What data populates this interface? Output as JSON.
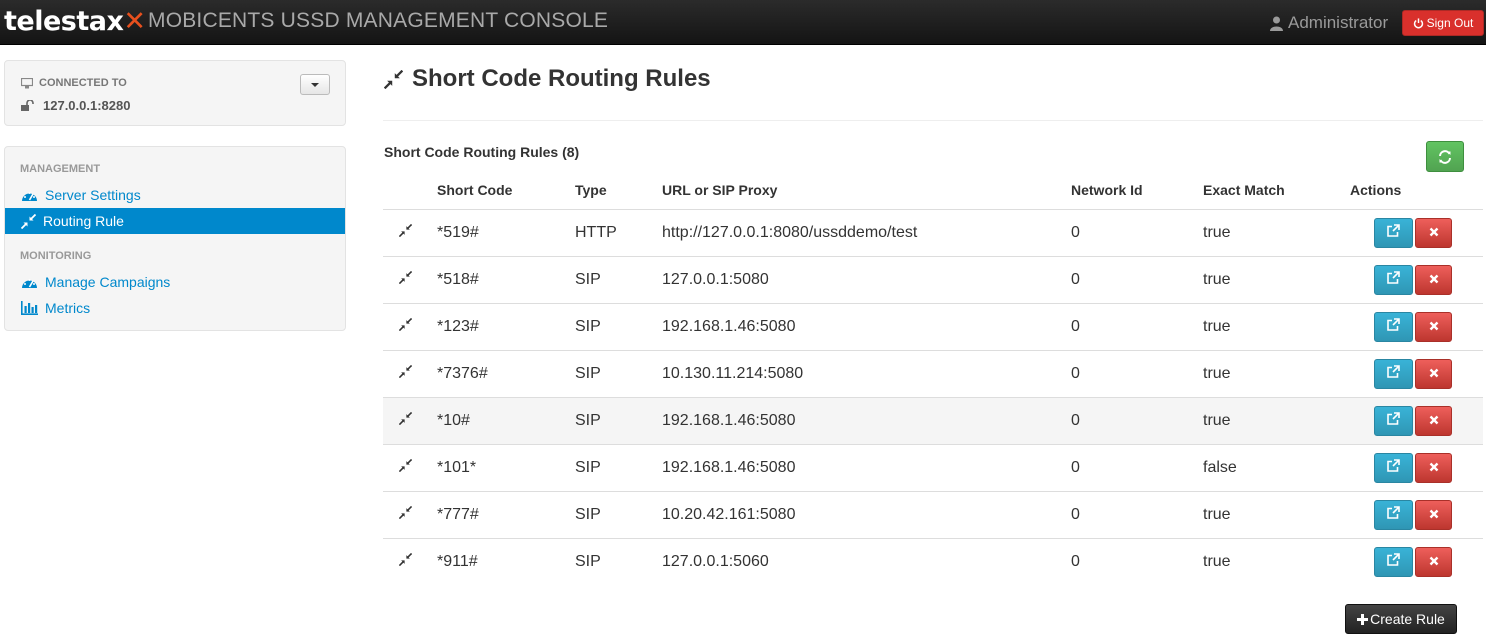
{
  "app": {
    "logo_text": "telestax",
    "console_title": "MOBICENTS USSD MANAGEMENT CONSOLE"
  },
  "header": {
    "user_name": "Administrator",
    "signout_label": "Sign Out"
  },
  "connection": {
    "label": "CONNECTED TO",
    "host": "127.0.0.1:8280"
  },
  "sidebar": {
    "management_header": "MANAGEMENT",
    "monitoring_header": "MONITORING",
    "items": [
      {
        "label": "Server Settings",
        "icon": "dashboard-icon"
      },
      {
        "label": "Routing Rule",
        "icon": "compress-icon",
        "active": true
      },
      {
        "label": "Manage Campaigns",
        "icon": "dashboard-icon"
      },
      {
        "label": "Metrics",
        "icon": "bar-chart-icon"
      }
    ]
  },
  "main": {
    "title": "Short Code Routing Rules",
    "table_caption": "Short Code Routing Rules (8)",
    "columns": [
      "",
      "Short Code",
      "Type",
      "URL or SIP Proxy",
      "Network Id",
      "Exact Match",
      "Actions"
    ],
    "rows": [
      {
        "short_code": "*519#",
        "type": "HTTP",
        "url": "http://127.0.0.1:8080/ussddemo/test",
        "network_id": "0",
        "exact_match": "true"
      },
      {
        "short_code": "*518#",
        "type": "SIP",
        "url": "127.0.0.1:5080",
        "network_id": "0",
        "exact_match": "true"
      },
      {
        "short_code": "*123#",
        "type": "SIP",
        "url": "192.168.1.46:5080",
        "network_id": "0",
        "exact_match": "true"
      },
      {
        "short_code": "*7376#",
        "type": "SIP",
        "url": "10.130.11.214:5080",
        "network_id": "0",
        "exact_match": "true"
      },
      {
        "short_code": "*10#",
        "type": "SIP",
        "url": "192.168.1.46:5080",
        "network_id": "0",
        "exact_match": "true",
        "hovered": true
      },
      {
        "short_code": "*101*",
        "type": "SIP",
        "url": "192.168.1.46:5080",
        "network_id": "0",
        "exact_match": "false"
      },
      {
        "short_code": "*777#",
        "type": "SIP",
        "url": "10.20.42.161:5080",
        "network_id": "0",
        "exact_match": "true"
      },
      {
        "short_code": "*911#",
        "type": "SIP",
        "url": "127.0.0.1:5060",
        "network_id": "0",
        "exact_match": "true"
      }
    ],
    "create_label": "Create Rule"
  },
  "colors": {
    "topbar": "#1b1b1b",
    "accent": "#0088cc",
    "danger": "#d9302c",
    "info": "#2f96b4",
    "success": "#51a351"
  }
}
